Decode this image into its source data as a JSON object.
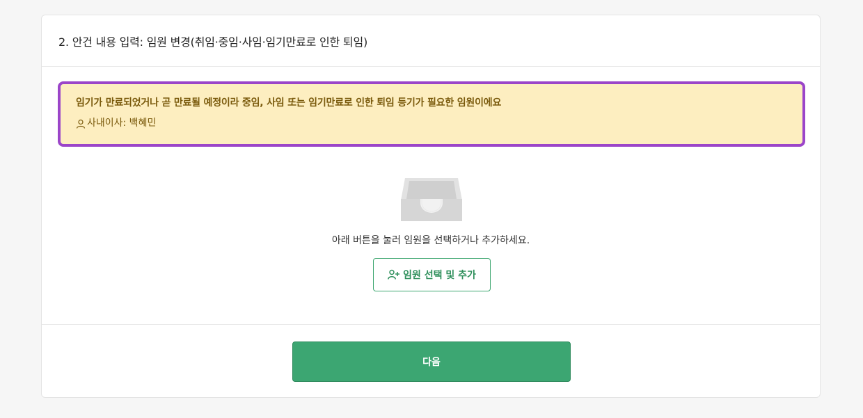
{
  "header": {
    "title": "2. 안건 내용 입력: 임원 변경(취임·중임·사임·임기만료로 인한 퇴임)"
  },
  "alert": {
    "message": "임기가 만료되었거나 곧 만료될 예정이라 중임, 사임 또는 임기만료로 인한 퇴임 등기가 필요한 임원이에요",
    "person": "사내이사: 백혜민",
    "person_icon": "user-icon",
    "background_color": "#fdeec0",
    "border_color": "#9b45c9"
  },
  "empty_state": {
    "icon": "inbox-tray-icon",
    "text": "아래 버튼을 눌러 임원을 선택하거나 추가하세요."
  },
  "select_button": {
    "label": "임원 선택 및 추가",
    "icon": "user-plus-icon",
    "color": "#2e8f5b"
  },
  "footer": {
    "next_label": "다음",
    "next_color": "#3ca672"
  }
}
